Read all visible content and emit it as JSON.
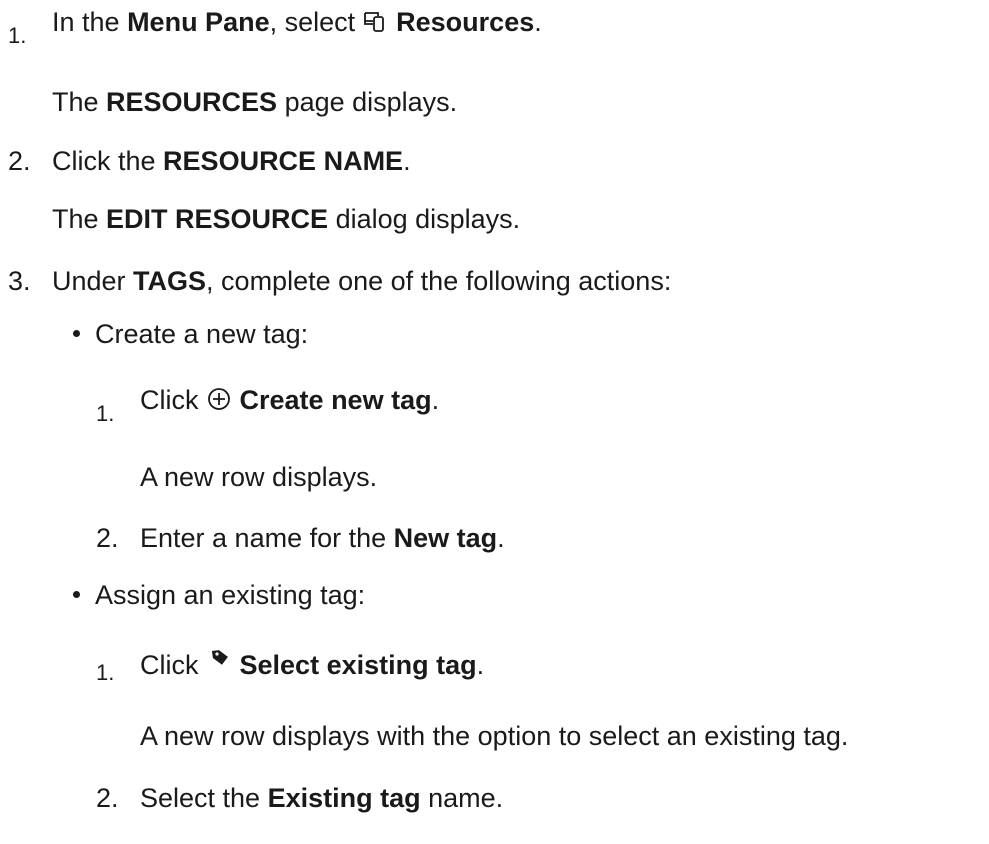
{
  "steps": [
    {
      "number": "1.",
      "text_before": "In the ",
      "bold_1": "Menu Pane",
      "text_mid": ", select ",
      "icon": "resources-icon",
      "bold_2": "Resources",
      "text_after": ".",
      "result_before": "The ",
      "result_bold": "RESOURCES",
      "result_after": " page displays."
    },
    {
      "number": "2.",
      "text_before": "Click the ",
      "bold_1": "RESOURCE NAME",
      "text_after": ".",
      "result_before": "The ",
      "result_bold": "EDIT RESOURCE",
      "result_after": " dialog displays."
    },
    {
      "number": "3.",
      "text_before": "Under ",
      "bold_1": "TAGS",
      "text_after": ", complete one of the following actions:"
    }
  ],
  "options": [
    {
      "label": "Create a new tag:",
      "substeps": [
        {
          "number": "1.",
          "text_before": "Click ",
          "icon": "plus-circle-icon",
          "bold": "Create new tag",
          "text_after": ".",
          "result": "A new row displays."
        },
        {
          "number": "2.",
          "text_before": "Enter a name for the ",
          "bold": "New tag",
          "text_after": "."
        }
      ]
    },
    {
      "label": "Assign an existing tag:",
      "substeps": [
        {
          "number": "1.",
          "text_before": "Click ",
          "icon": "tag-icon",
          "bold": "Select existing tag",
          "text_after": ".",
          "result": "A new row displays with the option to select an existing tag."
        },
        {
          "number": "2.",
          "text_before": "Select the ",
          "bold": "Existing tag",
          "text_after": " name."
        }
      ]
    }
  ]
}
